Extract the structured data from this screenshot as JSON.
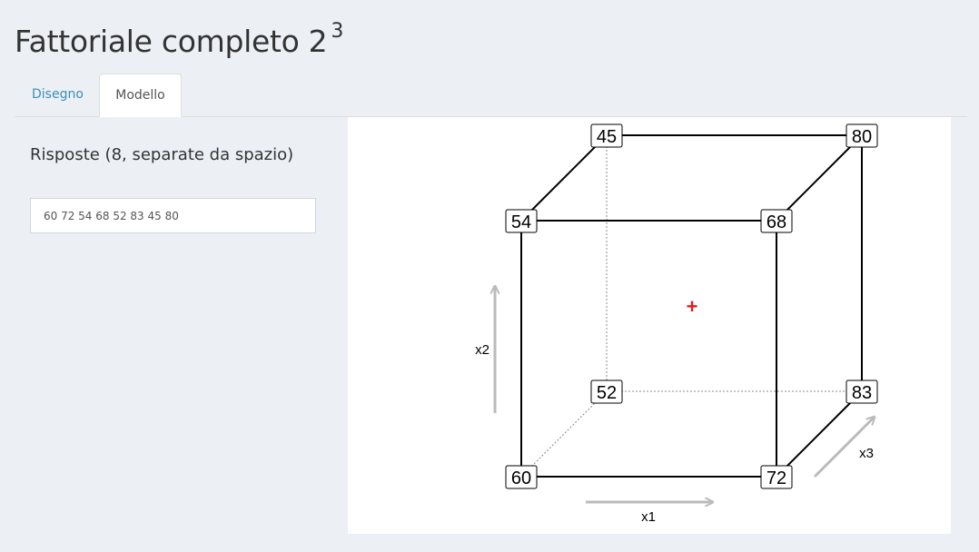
{
  "title": {
    "text": "Fattoriale completo 2",
    "exponent": "3"
  },
  "tabs": [
    {
      "label": "Disegno",
      "active": false
    },
    {
      "label": "Modello",
      "active": true
    }
  ],
  "responses": {
    "label": "Risposte (8, separate da spazio)",
    "value": "60 72 54 68 52 83 45 80"
  },
  "cube": {
    "vertices": {
      "front_bottom_left": "60",
      "front_bottom_right": "72",
      "front_top_left": "54",
      "front_top_right": "68",
      "back_bottom_left": "52",
      "back_bottom_right": "83",
      "back_top_left": "45",
      "back_top_right": "80"
    },
    "center_marker": "+",
    "axes": {
      "x1": "x1",
      "x2": "x2",
      "x3": "x3"
    },
    "colors": {
      "edges": "#000000",
      "axis_arrows": "#bbbbbb",
      "center_marker": "#e41a1c"
    }
  }
}
